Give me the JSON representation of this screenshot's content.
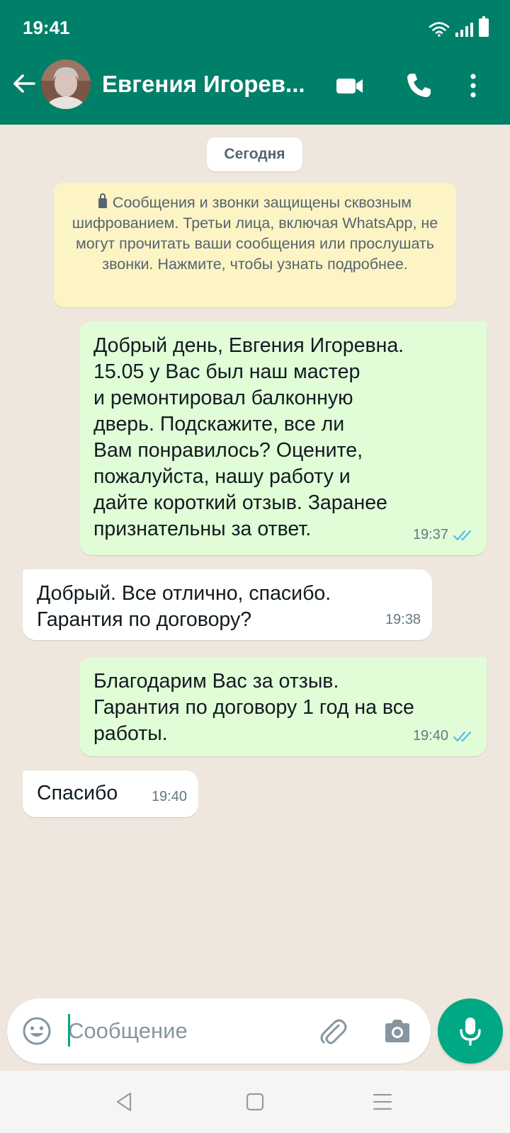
{
  "status_bar": {
    "time": "19:41"
  },
  "header": {
    "contact_name": "Евгения Игорев..."
  },
  "chat": {
    "date_chip": "Сегодня",
    "encryption_notice": "Сообщения и звонки защищены сквозным шифрованием. Третьи лица, включая WhatsApp, не могут прочитать ваши сообщения или прослушать звонки. Нажмите, чтобы узнать подробнее.",
    "messages": [
      {
        "direction": "outgoing",
        "text": "Добрый день, Евгения Игоревна.\n15.05 у Вас был наш мастер\nи ремонтировал балконную\nдверь. Подскажите, все ли\nВам понравилось? Оцените,\nпожалуйста, нашу работу и\nдайте короткий отзыв. Заранее\nпризнательны за ответ.",
        "time": "19:37",
        "status": "read"
      },
      {
        "direction": "incoming",
        "text": "Добрый. Все отлично, спасибо.\nГарантия по договору?",
        "time": "19:38"
      },
      {
        "direction": "outgoing",
        "text": "Благодарим Вас за отзыв.\nГарантия по договору 1 год на все\nработы.",
        "time": "19:40",
        "status": "read"
      },
      {
        "direction": "incoming",
        "text": "Спасибо",
        "time": "19:40"
      }
    ]
  },
  "composer": {
    "placeholder": "Сообщение",
    "value": ""
  },
  "colors": {
    "header": "#008069",
    "accent": "#00a884",
    "outgoing_bubble": "#e1fdd7",
    "read_ticks": "#53bdeb",
    "background": "#efe7dd"
  },
  "icons": [
    "back-arrow-icon",
    "video-call-icon",
    "voice-call-icon",
    "more-options-icon",
    "lock-icon",
    "double-check-icon",
    "emoji-icon",
    "attach-icon",
    "camera-icon",
    "mic-icon",
    "nav-back-icon",
    "nav-home-icon",
    "nav-menu-icon"
  ]
}
